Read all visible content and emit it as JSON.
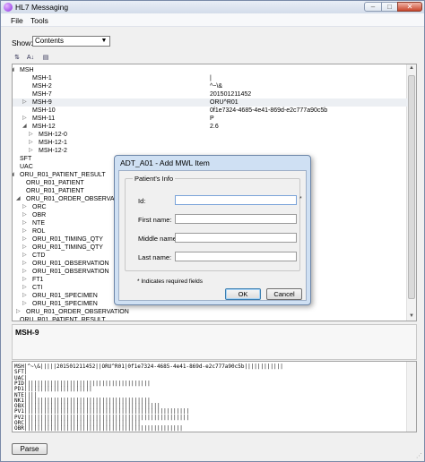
{
  "window": {
    "title": "HL7 Messaging",
    "min_glyph": "–",
    "max_glyph": "□",
    "close_glyph": "✕"
  },
  "menu": {
    "items": [
      "File",
      "Tools"
    ]
  },
  "show": {
    "label": "Show:",
    "value": "Contents",
    "arrow": "▼"
  },
  "toolbar": {
    "sort_icon_glyph": "⇅",
    "alpha_icon_glyph": "A↓",
    "view_icon_glyph": "▤"
  },
  "tree": {
    "rows": [
      {
        "label": "MSH",
        "indent": 0,
        "exp": "◢"
      },
      {
        "label": "MSH-1",
        "indent": 2,
        "value": "|"
      },
      {
        "label": "MSH-2",
        "indent": 2,
        "value": "^~\\&"
      },
      {
        "label": "MSH-7",
        "indent": 2,
        "value": "201501211452"
      },
      {
        "label": "MSH-9",
        "indent": 2,
        "exp": "▷",
        "value": "ORU^R01",
        "selected": true
      },
      {
        "label": "MSH-10",
        "indent": 2,
        "value": "0f1e7324-4685-4e41-869d-e2c777a90c5b"
      },
      {
        "label": "MSH-11",
        "indent": 2,
        "exp": "▷",
        "value": "P"
      },
      {
        "label": "MSH-12",
        "indent": 2,
        "exp": "◢",
        "value": "2.6"
      },
      {
        "label": "MSH-12-0",
        "indent": 3,
        "exp": "▷"
      },
      {
        "label": "MSH-12-1",
        "indent": 3,
        "exp": "▷"
      },
      {
        "label": "MSH-12-2",
        "indent": 3,
        "exp": "▷"
      },
      {
        "label": "SFT",
        "indent": 0
      },
      {
        "label": "UAC",
        "indent": 0
      },
      {
        "label": "ORU_R01_PATIENT_RESULT",
        "indent": 0,
        "exp": "◢"
      },
      {
        "label": "ORU_R01_PATIENT",
        "indent": 1
      },
      {
        "label": "ORU_R01_PATIENT",
        "indent": 1
      },
      {
        "label": "ORU_R01_ORDER_OBSERVATION",
        "indent": 1,
        "exp": "◢"
      },
      {
        "label": "ORC",
        "indent": 2,
        "exp": "▷"
      },
      {
        "label": "OBR",
        "indent": 2,
        "exp": "▷"
      },
      {
        "label": "NTE",
        "indent": 2,
        "exp": "▷"
      },
      {
        "label": "ROL",
        "indent": 2,
        "exp": "▷"
      },
      {
        "label": "ORU_R01_TIMING_QTY",
        "indent": 2,
        "exp": "▷"
      },
      {
        "label": "ORU_R01_TIMING_QTY",
        "indent": 2,
        "exp": "▷"
      },
      {
        "label": "CTD",
        "indent": 2,
        "exp": "▷"
      },
      {
        "label": "ORU_R01_OBSERVATION",
        "indent": 2,
        "exp": "▷"
      },
      {
        "label": "ORU_R01_OBSERVATION",
        "indent": 2,
        "exp": "▷"
      },
      {
        "label": "FT1",
        "indent": 2,
        "exp": "▷"
      },
      {
        "label": "CTI",
        "indent": 2,
        "exp": "▷"
      },
      {
        "label": "ORU_R01_SPECIMEN",
        "indent": 2,
        "exp": "▷"
      },
      {
        "label": "ORU_R01_SPECIMEN",
        "indent": 2,
        "exp": "▷"
      },
      {
        "label": "ORU_R01_ORDER_OBSERVATION",
        "indent": 1,
        "exp": "▷"
      },
      {
        "label": "ORU_R01_PATIENT_RESULT",
        "indent": 0
      }
    ]
  },
  "info": {
    "title": "MSH-9"
  },
  "raw": {
    "lines": [
      "MSH|^~\\&|||||201501211452||ORU^R01|0f1e7324-4685-4e41-869d-e2c777a90c5b||||||||||||",
      "SFT|",
      "UAC|",
      "PID|||||||||||||||||||||||||||||||||||||||",
      "PD1|||||||||||||||||||||",
      "NTE||||",
      "NK1|||||||||||||||||||||||||||||||||||||||",
      "OBX||||||||||||||||||||||||||||||||||||||||||",
      "PV1|||||||||||||||||||||||||||||||||||||||||||||||||||",
      "PV2|||||||||||||||||||||||||||||||||||||||||||||||||||",
      "ORC||||||||||||||||||||||||||||||||||||",
      "OBR|||||||||||||||||||||||||||||||||||||||||||||||||"
    ]
  },
  "parse_button": "Parse",
  "dialog": {
    "title": "ADT_A01 - Add MWL Item",
    "group_label": "Patient's Info",
    "fields": [
      {
        "label": "Id:",
        "value": "",
        "required": true
      },
      {
        "label": "First name:",
        "value": ""
      },
      {
        "label": "Middle name:",
        "value": ""
      },
      {
        "label": "Last name:",
        "value": ""
      }
    ],
    "required_mark": "*",
    "note": "*    Indicates required fields",
    "ok": "OK",
    "cancel": "Cancel"
  }
}
